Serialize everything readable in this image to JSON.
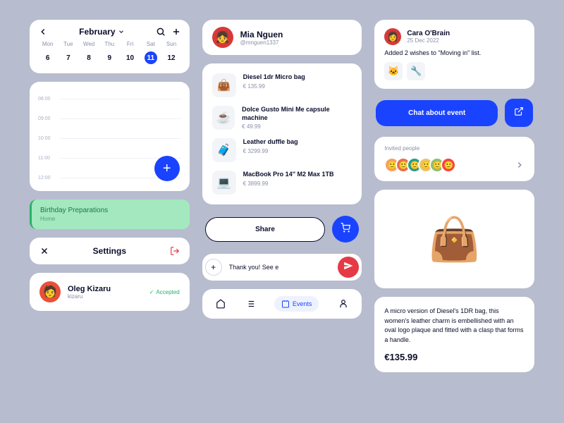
{
  "calendar": {
    "month": "February",
    "days": [
      "Mon",
      "Tue",
      "Wed",
      "Thu",
      "Fri",
      "Sat",
      "Sun"
    ],
    "dates": [
      "6",
      "7",
      "8",
      "9",
      "10",
      "11",
      "12"
    ],
    "selected": 5,
    "times": [
      "08:00",
      "09:00",
      "10:00",
      "11:00",
      "12:00"
    ]
  },
  "event_chip": {
    "title": "Birthday Preparations",
    "subtitle": "Home"
  },
  "settings": {
    "title": "Settings"
  },
  "user1": {
    "name": "Oleg Kizaru",
    "handle": "kizaru",
    "status": "Accepted"
  },
  "profile": {
    "name": "Mia Nguen",
    "handle": "@mnguen1337"
  },
  "products": [
    {
      "name": "Diesel 1dr Micro bag",
      "price": "€ 135.99",
      "emoji": "👜"
    },
    {
      "name": "Dolce Gusto Mini Me capsule machine",
      "price": "€ 49.99",
      "emoji": "☕"
    },
    {
      "name": "Leather duffle bag",
      "price": "€ 3299.99",
      "emoji": "🧳"
    },
    {
      "name": "MacBook Pro 14'' M2 Max 1TB",
      "price": "€ 3899.99",
      "emoji": "💻"
    }
  ],
  "share": {
    "label": "Share"
  },
  "message": {
    "placeholder": "Thank you! See e"
  },
  "nav": {
    "events": "Events"
  },
  "feed": {
    "name": "Cara O'Brain",
    "date": "25 Dec 2022",
    "text": "Added 2 wishes to \"Moving in\" list."
  },
  "chat": {
    "label": "Chat about event"
  },
  "invited": {
    "title": "Invited people"
  },
  "detail": {
    "text": "A micro version of Diesel's 1DR bag, this women's leather charm is embellished with an oval logo plaque and fitted with a clasp that forms a handle.",
    "price": "€135.99"
  },
  "avatars_colors": [
    "#f4a261",
    "#e76f51",
    "#2a9d8f",
    "#e9c46a",
    "#90be6d",
    "#f94144"
  ]
}
